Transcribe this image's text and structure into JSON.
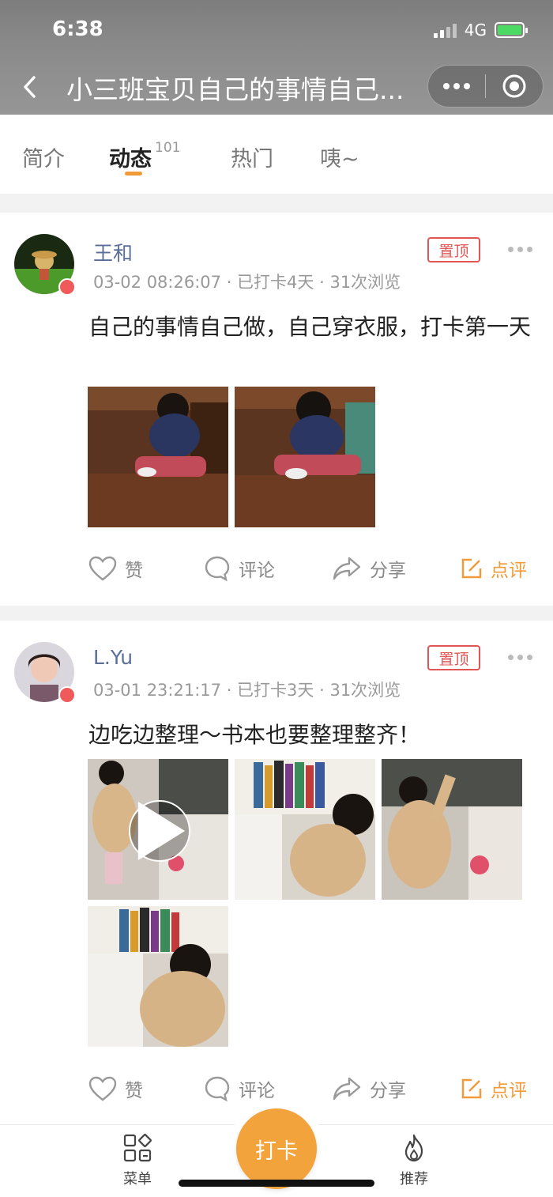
{
  "status_bar": {
    "time": "6:38",
    "network": "4G"
  },
  "header": {
    "title": "小三班宝贝自己的事情自己..."
  },
  "tabs": [
    {
      "label": "简介"
    },
    {
      "label": "动态",
      "count": "101"
    },
    {
      "label": "热门"
    },
    {
      "label": "咦~"
    }
  ],
  "posts": [
    {
      "author": "王和",
      "pin": "置顶",
      "time": "03-02 08:26:07",
      "checkin": "已打卡4天",
      "views": "31次浏览",
      "text": "自己的事情自己做，自己穿衣服，打卡第一天"
    },
    {
      "author": "L.Yu",
      "pin": "置顶",
      "time": "03-01 23:21:17",
      "checkin": "已打卡3天",
      "views": "31次浏览",
      "text": "边吃边整理～书本也要整理整齐！"
    }
  ],
  "actions": {
    "like": "赞",
    "comment": "评论",
    "share": "分享",
    "review": "点评"
  },
  "bottom_nav": {
    "menu": "菜单",
    "checkin": "打卡",
    "recommend": "推荐"
  },
  "colors": {
    "accent": "#f29a38",
    "pin": "#e25555",
    "author": "#5a6e9a"
  },
  "icons": [
    "back-icon",
    "more-dots-icon",
    "target-icon",
    "heart-icon",
    "comment-icon",
    "share-icon",
    "edit-icon",
    "menu-grid-icon",
    "fire-icon",
    "play-icon"
  ]
}
